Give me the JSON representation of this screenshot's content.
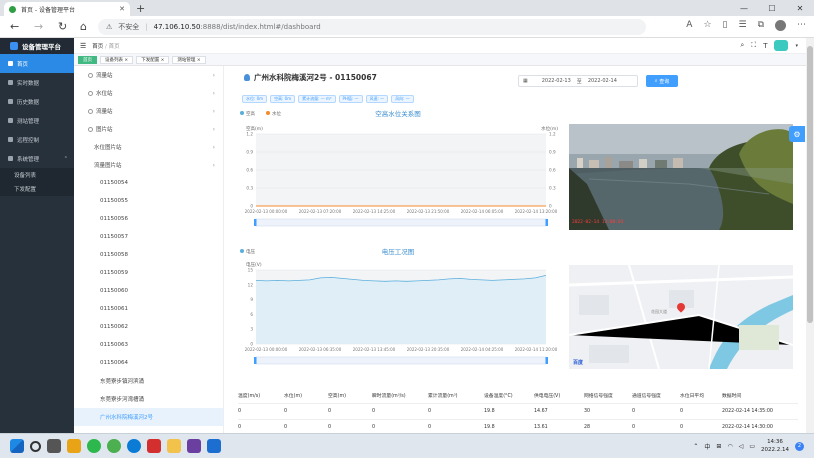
{
  "browser": {
    "tab_title": "首页 - 设备管理平台",
    "url_warning": "不安全",
    "url_host": "47.106.10.50",
    "url_rest": ":8888/dist/index.html#/dashboard"
  },
  "sidebar": {
    "app_title": "设备管理平台",
    "items": [
      {
        "label": "首页"
      },
      {
        "label": "实时数据"
      },
      {
        "label": "历史数据"
      },
      {
        "label": "测站管理"
      },
      {
        "label": "远程控制"
      },
      {
        "label": "系统管理"
      }
    ],
    "subitems": [
      {
        "label": "设备列表"
      },
      {
        "label": "下发配置"
      }
    ]
  },
  "header": {
    "breadcrumb_home": "首页",
    "breadcrumb_sep": "/",
    "breadcrumb_current": "首页"
  },
  "tags": [
    {
      "label": "首页"
    },
    {
      "label": "设备列表 ×"
    },
    {
      "label": "下发配置 ×"
    },
    {
      "label": "测站管理 ×"
    }
  ],
  "tree": [
    {
      "label": "流量站",
      "level": 0,
      "arrow": true
    },
    {
      "label": "水位站",
      "level": 0,
      "arrow": true
    },
    {
      "label": "流量站",
      "level": 0,
      "arrow": true
    },
    {
      "label": "图片站",
      "level": 0,
      "arrow": true
    },
    {
      "label": "水位图片站",
      "level": 1,
      "arrow": true
    },
    {
      "label": "流量图片站",
      "level": 1,
      "arrow": true
    },
    {
      "label": "01150054",
      "level": 2
    },
    {
      "label": "01150055",
      "level": 2
    },
    {
      "label": "01150056",
      "level": 2
    },
    {
      "label": "01150057",
      "level": 2
    },
    {
      "label": "01150058",
      "level": 2
    },
    {
      "label": "01150059",
      "level": 2
    },
    {
      "label": "01150060",
      "level": 2
    },
    {
      "label": "01150061",
      "level": 2
    },
    {
      "label": "01150062",
      "level": 2
    },
    {
      "label": "01150063",
      "level": 2
    },
    {
      "label": "01150064",
      "level": 2
    },
    {
      "label": "东莞寮步镇河滨涌",
      "level": 2
    },
    {
      "label": "东莞寮步河湾槽涌",
      "level": 2
    },
    {
      "label": "广州水科院梅溪河2号",
      "level": 2,
      "selected": true
    }
  ],
  "station": {
    "title": "广州水科院梅溪河2号 - 01150067",
    "date_from": "2022-02-13",
    "date_to": "2022-02-14",
    "date_sep": "至",
    "query_label": "查询"
  },
  "chips": [
    {
      "label": "水位: 0m"
    },
    {
      "label": "空高: 0m"
    },
    {
      "label": "累计流量: — m³"
    },
    {
      "label": "PH值: —"
    },
    {
      "label": "风速: —"
    },
    {
      "label": "风向: —"
    }
  ],
  "camera": {
    "timestamp": "2022-02-14 13:00:03"
  },
  "map": {
    "road_label": "花园大道",
    "logo": "百度"
  },
  "table": {
    "headers": [
      "温度(m/s)",
      "水位(m)",
      "空高(m)",
      "瞬时流量(m³/s)",
      "累计流量(m³)",
      "设备温度(°C)",
      "供电电压(V)",
      "网络信号强度",
      "通道信号强度",
      "水位日平均"
    ],
    "rows": [
      [
        "0",
        "0",
        "0",
        "0",
        "0",
        "19.8",
        "14.67",
        "30",
        "0",
        "0"
      ],
      [
        "0",
        "0",
        "0",
        "0",
        "0",
        "19.8",
        "13.61",
        "28",
        "0",
        "0"
      ]
    ]
  },
  "right_table": {
    "header": "数据时间",
    "rows": [
      "2022-02-14 14:35:00",
      "2022-02-14 14:30:00"
    ]
  },
  "taskbar": {
    "time": "14:36",
    "date": "2022.2.14",
    "lang": "中",
    "notif": "2"
  },
  "colors": {
    "accent": "#409eff",
    "sidebar": "#27313c",
    "chart_line": "#5aaedc",
    "flow_line": "#f58a2e"
  },
  "chart_data": [
    {
      "type": "line",
      "title": "空高水位关系图",
      "ylabel": "空高(m)",
      "y2label": "水位(m)",
      "ylim": [
        0,
        1.2
      ],
      "yticks": [
        0,
        0.3,
        0.6,
        0.9,
        1.2
      ],
      "y2ticks": [
        0,
        0.3,
        0.6,
        0.9,
        1.2
      ],
      "xticks": [
        "2022-02-13 00:00:00",
        "2022-02-13 07:20:00",
        "2022-02-13 14:25:00",
        "2022-02-13 21:50:00",
        "2022-02-14 06:05:00",
        "2022-02-14 13:20:00"
      ],
      "series": [
        {
          "name": "空高",
          "values": [
            0,
            0,
            0,
            0,
            0,
            0
          ]
        },
        {
          "name": "水位",
          "values": [
            0,
            0,
            0,
            0,
            0,
            0
          ]
        }
      ]
    },
    {
      "type": "area",
      "title": "电压工况图",
      "ylabel": "电压(V)",
      "ylim": [
        0,
        15
      ],
      "yticks": [
        0,
        3,
        6,
        9,
        12,
        15
      ],
      "xticks": [
        "2022-02-13 00:00:00",
        "2022-02-13 06:35:00",
        "2022-02-13 13:45:00",
        "2022-02-13 20:35:00",
        "2022-02-14 04:25:00",
        "2022-02-14 11:20:00"
      ],
      "series": [
        {
          "name": "电压",
          "values": [
            12.9,
            12.8,
            12.9,
            12.8,
            12.9,
            13.0,
            13.4,
            13.5,
            13.3,
            13.1,
            12.9,
            12.8,
            12.7,
            12.8,
            12.7,
            12.8,
            12.9,
            13.0,
            13.2,
            13.3,
            13.1,
            13.0,
            12.9,
            13.0,
            13.1,
            13.2,
            13.4,
            13.9
          ]
        }
      ]
    }
  ]
}
